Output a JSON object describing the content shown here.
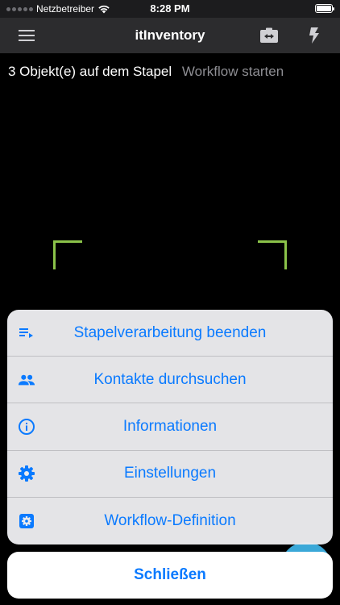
{
  "status_bar": {
    "carrier": "Netzbetreiber",
    "time": "8:28 PM",
    "icons": [
      "signal-dots-icon",
      "wifi-icon",
      "battery-icon"
    ]
  },
  "nav": {
    "title": "itInventory",
    "left_icon": "menu-icon",
    "right_icons": [
      "camera-switch-icon",
      "flash-icon"
    ]
  },
  "stack": {
    "count_text": "3 Objekt(e) auf dem Stapel",
    "workflow_text": "Workflow starten"
  },
  "action_sheet": {
    "items": [
      {
        "label": "Stapelverarbeitung beenden",
        "icon": "playlist-icon"
      },
      {
        "label": "Kontakte durchsuchen",
        "icon": "contacts-icon"
      },
      {
        "label": "Informationen",
        "icon": "info-icon"
      },
      {
        "label": "Einstellungen",
        "icon": "gear-icon"
      },
      {
        "label": "Workflow-Definition",
        "icon": "workflow-settings-icon"
      }
    ],
    "cancel_label": "Schließen"
  },
  "colors": {
    "accent": "#0a7aff",
    "scan_frame": "#8bc34a",
    "fab": "#3aa8d8",
    "nav_background": "#2c2c2e"
  }
}
